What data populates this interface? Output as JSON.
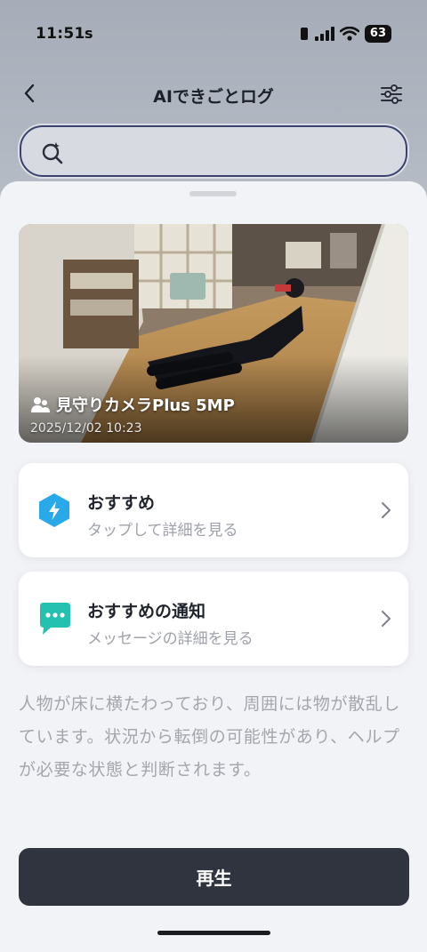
{
  "status_bar": {
    "time": "11:51",
    "carrier_indicator": "s",
    "battery_level": "63",
    "icons": [
      "orientation-lock-icon",
      "cellular-signal-icon",
      "wifi-icon",
      "battery-icon"
    ]
  },
  "header": {
    "title": "AIできごとログ",
    "back_icon": "chevron-left-icon",
    "filter_icon": "sliders-icon"
  },
  "search": {
    "value": "",
    "icon": "ai-search-icon"
  },
  "event": {
    "camera_name": "見守りカメラPlus 5MP",
    "timestamp": "2025/12/02 10:23",
    "camera_icon": "people-icon"
  },
  "cards": [
    {
      "title": "おすすめ",
      "subtitle": "タップして詳細を見る",
      "icon": "bolt-hexagon-icon",
      "color": "#2aa9e8"
    },
    {
      "title": "おすすめの通知",
      "subtitle": "メッセージの詳細を見る",
      "icon": "chat-bubble-icon",
      "color": "#24c1b0"
    }
  ],
  "description": "人物が床に横たわっており、周囲には物が散乱しています。状況から転倒の可能性があり、ヘルプが必要な状態と判断されます。",
  "play_button": {
    "label": "再生"
  },
  "colors": {
    "primary_button": "#30343f",
    "search_border": "#3a4270",
    "sheet_background": "#f2f3f6"
  }
}
